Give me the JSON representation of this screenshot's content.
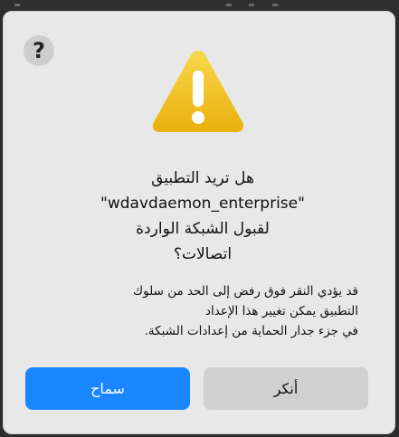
{
  "dialog": {
    "help_icon": "question-mark-icon",
    "warning_icon": "warning-triangle-icon",
    "title_line1": "هل تريد التطبيق",
    "title_app": "\"wdavdaemon_enterprise\"",
    "title_line3": "لقبول الشبكة الواردة",
    "title_line4": "اتصالات؟",
    "body_line1": "قد يؤدي النقر فوق رفض إلى الحد من سلوك",
    "body_line2": "التطبيق يمكن تغيير هذا الإعداد",
    "body_line3": "في جزء جدار الحماية من إعدادات الشبكة.",
    "allow_label": "سماح",
    "deny_label": "أنكر"
  },
  "colors": {
    "accent": "#1a86ff",
    "warning": "#f2c21a"
  }
}
